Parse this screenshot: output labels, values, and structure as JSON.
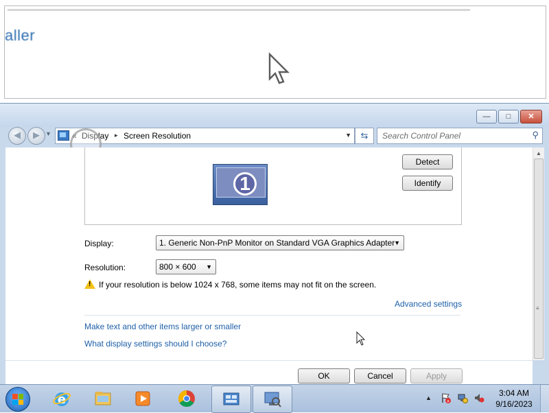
{
  "background_zoom": {
    "text": "aller"
  },
  "window": {
    "caption": {
      "minimize": "—",
      "maximize": "□",
      "close": "✕"
    },
    "nav": {
      "back_icon": "back-arrow-icon",
      "forward_icon": "forward-arrow-icon"
    },
    "address": {
      "prefix": "«",
      "crumbs": [
        "Display",
        "Screen Resolution"
      ],
      "separator": "▸"
    },
    "search": {
      "placeholder": "Search Control Panel"
    }
  },
  "panel": {
    "monitor_number": "1",
    "detect_label": "Detect",
    "identify_label": "Identify",
    "display_label": "Display:",
    "display_value": "1. Generic Non-PnP Monitor on Standard VGA Graphics Adapter",
    "resolution_label": "Resolution:",
    "resolution_value": "800 × 600",
    "warning_text": "If your resolution is below 1024 x 768, some items may not fit on the screen.",
    "advanced_link": "Advanced settings",
    "links": [
      "Make text and other items larger or smaller",
      "What display settings should I choose?"
    ],
    "ok_label": "OK",
    "cancel_label": "Cancel",
    "apply_label": "Apply"
  },
  "taskbar": {
    "apps": [
      "internet-explorer",
      "file-explorer",
      "media-player",
      "chrome",
      "control-panel",
      "display-settings"
    ],
    "clock_time": "3:04 AM",
    "clock_date": "9/16/2023"
  },
  "colors": {
    "link": "#1d5fa8",
    "window_frame": "#c9d9ec",
    "taskbar": "#b3c7e0"
  }
}
